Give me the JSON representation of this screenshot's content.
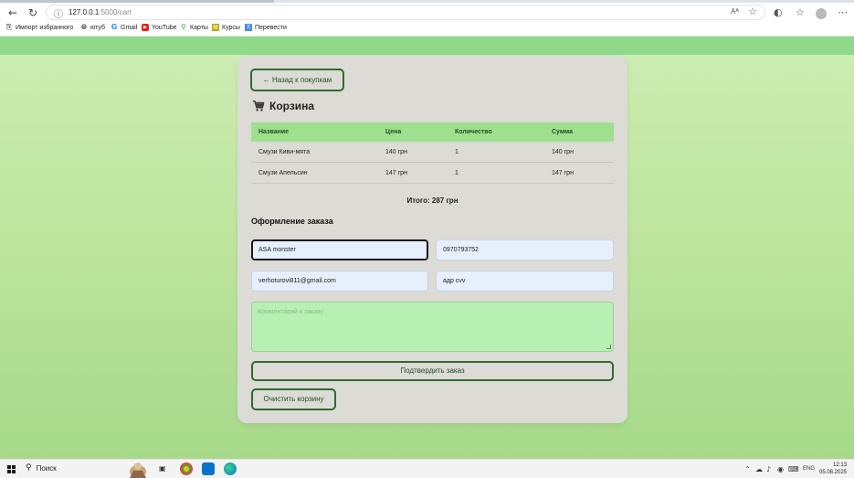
{
  "browser": {
    "url_host": "127.0.0.1",
    "url_path": ":5000/cart",
    "reader_label": "Aᴬ"
  },
  "bookmarks": [
    {
      "label": "Импорт избранного",
      "icon": "import-icon"
    },
    {
      "label": "ютуб",
      "icon": "globe-icon"
    },
    {
      "label": "Gmail",
      "icon": "google-icon"
    },
    {
      "label": "YouTube",
      "icon": "youtube-icon"
    },
    {
      "label": "Карты",
      "icon": "map-pin-icon"
    },
    {
      "label": "Курсы",
      "icon": "courses-icon"
    },
    {
      "label": "Перевести",
      "icon": "translate-icon"
    }
  ],
  "page": {
    "back_label": "← Назад к покупкам",
    "title": "Корзина",
    "table": {
      "headers": [
        "Название",
        "Цена",
        "Количество",
        "Сумма"
      ],
      "rows": [
        [
          "Смузи Киви-мята",
          "140 грн",
          "1",
          "140 грн"
        ],
        [
          "Смузи Апельсин",
          "147 грн",
          "1",
          "147 грн"
        ]
      ]
    },
    "total": "Итого: 287 грн",
    "checkout_title": "Оформление заказа",
    "form": {
      "name_value": "ASA monster",
      "phone_value": "0970793752",
      "email_value": "verhoturovi811@gmail.com",
      "address_value": "адр cvv",
      "comment_placeholder": "Комментарий к заказу"
    },
    "confirm_label": "Подтвердить заказ",
    "clear_label": "Очистить корзину"
  },
  "taskbar": {
    "search_label": "Поиск",
    "lang": "ENG",
    "time": "12:13",
    "date": "05.08.2025"
  },
  "colors": {
    "header_green": "#8fd98a",
    "table_head": "#9fe08f",
    "button_border": "#2f6b2f",
    "comment_bg": "#b8f0b3"
  }
}
